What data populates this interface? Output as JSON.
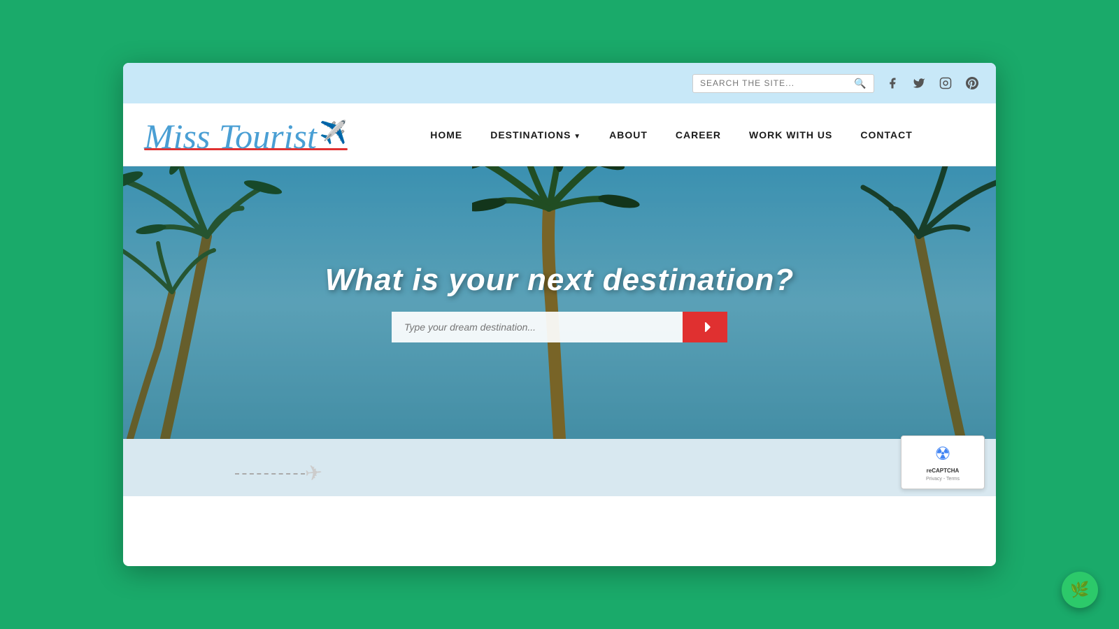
{
  "browser": {
    "title": "Miss Tourist"
  },
  "topbar": {
    "search_placeholder": "Search the site...",
    "search_icon": "search-icon",
    "social": [
      {
        "name": "facebook-icon",
        "symbol": "f"
      },
      {
        "name": "twitter-icon",
        "symbol": "t"
      },
      {
        "name": "instagram-icon",
        "symbol": "i"
      },
      {
        "name": "pinterest-icon",
        "symbol": "p"
      }
    ]
  },
  "nav": {
    "logo_text": "Miss Tourist",
    "links": [
      {
        "label": "HOME",
        "id": "home"
      },
      {
        "label": "DESTINATIONS",
        "id": "destinations",
        "hasArrow": true
      },
      {
        "label": "ABOUT",
        "id": "about"
      },
      {
        "label": "CAREER",
        "id": "career"
      },
      {
        "label": "WORK WITH US",
        "id": "work-with-us"
      },
      {
        "label": "CONTACT",
        "id": "contact"
      }
    ]
  },
  "hero": {
    "title": "What is your next destination?",
    "search_placeholder": "Type your dream destination...",
    "search_button_label": "→"
  },
  "bottom": {
    "recaptcha_label": "reCAPTCHA",
    "recaptcha_sub": "Privacy - Terms"
  },
  "badge": {
    "icon": "leaf-icon"
  }
}
